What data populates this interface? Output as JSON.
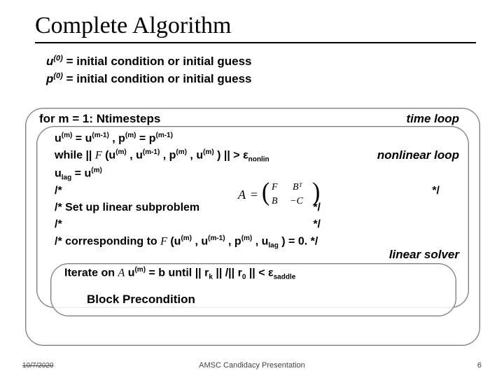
{
  "title": "Complete Algorithm",
  "ic": {
    "u_var": "u",
    "u_sup": "(0)",
    "u_rest": " = initial condition or initial guess",
    "p_var": "p",
    "p_sup": "(0)",
    "p_rest": " = initial condition or initial guess"
  },
  "loops": {
    "for_line": "for m = 1: Ntimesteps",
    "time_label": "time loop",
    "nonlin_label": "nonlinear loop",
    "linear_label": "linear solver"
  },
  "mid": {
    "l1_a": "u",
    "l1_sup1": "(m)",
    "l1_b": " = u",
    "l1_sup2": "(m-1)",
    "l1_c": " ,  p",
    "l1_sup3": "(m)",
    "l1_d": " = p",
    "l1_sup4": "(m-1)",
    "l2_a": "while || ",
    "l2_F": "F",
    "l2_b": " (u",
    "l2_s1": "(m)",
    "l2_c": " , u",
    "l2_s2": "(m-1)",
    "l2_d": " , p",
    "l2_s3": "(m)",
    "l2_e": " , u",
    "l2_s4": "(m)",
    "l2_f": " ) || > ε",
    "l2_sub": "nonlin",
    "l3_a": "u",
    "l3_sub": "lag",
    "l3_b": " = u",
    "l3_sup": "(m)",
    "l4_a": "/*",
    "l4_star": "*/",
    "l5_a": "/* Set up linear subproblem",
    "l5_star": "*/",
    "l6_a": "/*",
    "l6_star": "*/",
    "l7_a": "/* corresponding to ",
    "l7_F": "F",
    "l7_b": " (u",
    "l7_s1": "(m)",
    "l7_c": " , u",
    "l7_s2": "(m-1)",
    "l7_d": " , p",
    "l7_s3": "(m)",
    "l7_e": " , u",
    "l7_sub": "lag",
    "l7_f": " ) = 0. */"
  },
  "matrix": {
    "A": "A",
    "eq": "=",
    "F": "F",
    "BT": "Bᵀ",
    "B": "B",
    "mC": "−C"
  },
  "iterate": {
    "a": "Iterate on ",
    "A": "A",
    "b": " u",
    "s1": "(m)",
    "c": " = b until || r",
    "sub_k": "k",
    "d": " || /|| r",
    "sub_0": "0",
    "e": " || < ε",
    "sub_s": "saddle"
  },
  "block_pre": "Block Precondition",
  "footer": {
    "date": "10/7/2020",
    "center": "AMSC Candidacy Presentation",
    "num": "6"
  }
}
